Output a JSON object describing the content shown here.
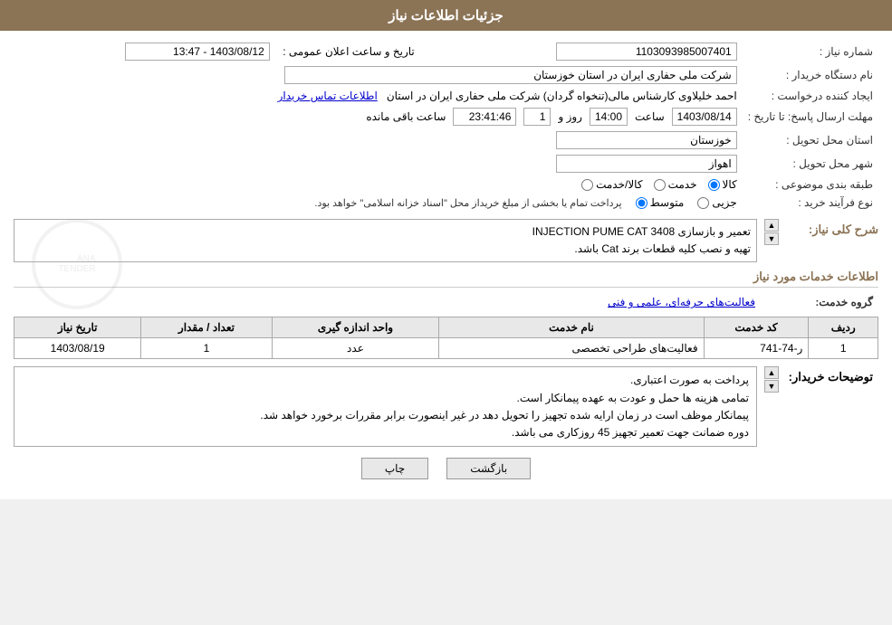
{
  "header": {
    "title": "جزئیات اطلاعات نیاز"
  },
  "fields": {
    "need_number_label": "شماره نیاز :",
    "need_number_value": "1103093985007401",
    "buyer_org_label": "نام دستگاه خریدار :",
    "buyer_org_value": "شرکت ملی حفاری ایران در استان خوزستان",
    "requester_label": "ایجاد کننده درخواست :",
    "requester_value": "احمد خلیلاوی کارشناس مالی(تنخواه گردان) شرکت ملی حفاری ایران در استان",
    "requester_link": "اطلاعات تماس خریدار",
    "deadline_label": "مهلت ارسال پاسخ: تا تاریخ :",
    "deadline_date": "1403/08/14",
    "deadline_time_label": "ساعت",
    "deadline_time": "14:00",
    "deadline_days_label": "روز و",
    "deadline_days": "1",
    "deadline_remaining": "23:41:46",
    "deadline_remaining_label": "ساعت باقی مانده",
    "province_label": "استان محل تحویل :",
    "province_value": "خوزستان",
    "city_label": "شهر محل تحویل :",
    "city_value": "اهواز",
    "category_label": "طبقه بندی موضوعی :",
    "category_options": [
      "کالا",
      "خدمت",
      "کالا/خدمت"
    ],
    "category_selected": "کالا",
    "process_label": "نوع فرآیند خرید :",
    "process_options": [
      "جزیی",
      "متوسط"
    ],
    "process_selected": "متوسط",
    "process_note": "پرداخت تمام یا بخشی از مبلغ خریداز محل \"اسناد خزانه اسلامی\" خواهد بود.",
    "announce_date_label": "تاریخ و ساعت اعلان عمومی :",
    "announce_date_value": "1403/08/12 - 13:47",
    "description_section_label": "شرح کلی نیاز:",
    "description_text1": "تعمیر و بازسازی INJECTION PUME CAT 3408",
    "description_text2": "تهیه و نصب کلیه قطعات برند Cat باشد.",
    "services_section_label": "اطلاعات خدمات مورد نیاز",
    "service_group_label": "گروه خدمت:",
    "service_group_value": "فعالیت‌های حرفه‌ای، علمی و فنی",
    "table": {
      "headers": [
        "ردیف",
        "کد خدمت",
        "نام خدمت",
        "واحد اندازه گیری",
        "تعداد / مقدار",
        "تاریخ نیاز"
      ],
      "rows": [
        {
          "row": "1",
          "code": "ر-74-741",
          "name": "فعالیت‌های طراحی تخصصی",
          "unit": "عدد",
          "qty": "1",
          "date": "1403/08/19"
        }
      ]
    },
    "notes_label": "توضیحات خریدار:",
    "notes_lines": [
      "پرداخت به صورت اعتباری.",
      "تمامی هزینه ها حمل و عودت به عهده پیمانکار است.",
      "پیمانکار موظف است در زمان ارایه شده تجهیز را تحویل دهد در غیر اینصورت برابر مقررات برخورد خواهد شد.",
      "دوره ضمانت جهت تعمیر تجهیز 45 روزکاری می باشد."
    ]
  },
  "buttons": {
    "print_label": "چاپ",
    "back_label": "بازگشت"
  }
}
